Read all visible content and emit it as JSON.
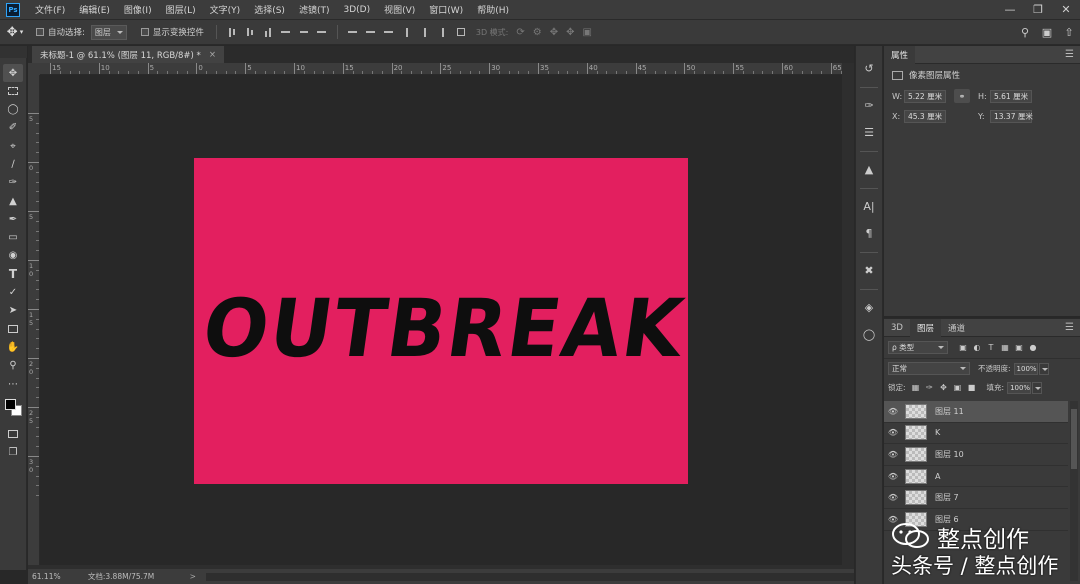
{
  "app": {
    "logo": "Ps"
  },
  "menu": [
    "文件(F)",
    "编辑(E)",
    "图像(I)",
    "图层(L)",
    "文字(Y)",
    "选择(S)",
    "滤镜(T)",
    "3D(D)",
    "视图(V)",
    "窗口(W)",
    "帮助(H)"
  ],
  "window_controls": [
    "minimize-icon",
    "restore-icon",
    "close-icon"
  ],
  "options": {
    "auto_select_label": "自动选择:",
    "auto_select_value": "图层",
    "show_transform_label": "显示变换控件",
    "mode_3d_label": "3D 模式:"
  },
  "document": {
    "tab_title": "未标题-1 @ 61.1% (图层 11, RGB/8#) *",
    "close": "×",
    "artwork_text": "OUTBREAK",
    "background_color": "#e31f5f",
    "text_color": "#0e0e0e"
  },
  "ruler_h_labels": [
    "15",
    "10",
    "5",
    "0",
    "5",
    "10",
    "15",
    "20",
    "25",
    "30",
    "35",
    "40",
    "45",
    "50",
    "55",
    "60",
    "65"
  ],
  "ruler_v_labels": [
    "5",
    "0",
    "5",
    "1 0",
    "1 5",
    "2 0",
    "2 5",
    "3 0"
  ],
  "status": {
    "zoom": "61.11%",
    "doc": "文档:3.88M/75.7M",
    "arrow": ">"
  },
  "properties": {
    "tab": "属性",
    "title": "像素图层属性",
    "w_label": "W:",
    "w_value": "5.22 厘米",
    "h_label": "H:",
    "h_value": "5.61 厘米",
    "x_label": "X:",
    "x_value": "45.3 厘米",
    "y_label": "Y:",
    "y_value": "13.37 厘米"
  },
  "layers_panel": {
    "tabs": [
      "3D",
      "图层",
      "通道"
    ],
    "filter_kind": "ρ 类型",
    "blend_mode": "正常",
    "opacity_label": "不透明度:",
    "opacity_value": "100%",
    "lock_label": "锁定:",
    "fill_label": "填充:",
    "fill_value": "100%",
    "items": [
      {
        "name": "图层 11",
        "selected": true
      },
      {
        "name": "K",
        "selected": false
      },
      {
        "name": "图层 10",
        "selected": false
      },
      {
        "name": "A",
        "selected": false
      },
      {
        "name": "图层 7",
        "selected": false
      },
      {
        "name": "图层 6",
        "selected": false
      }
    ]
  },
  "watermark": {
    "line1": "整点创作",
    "line2": "头条号 / 整点创作"
  }
}
